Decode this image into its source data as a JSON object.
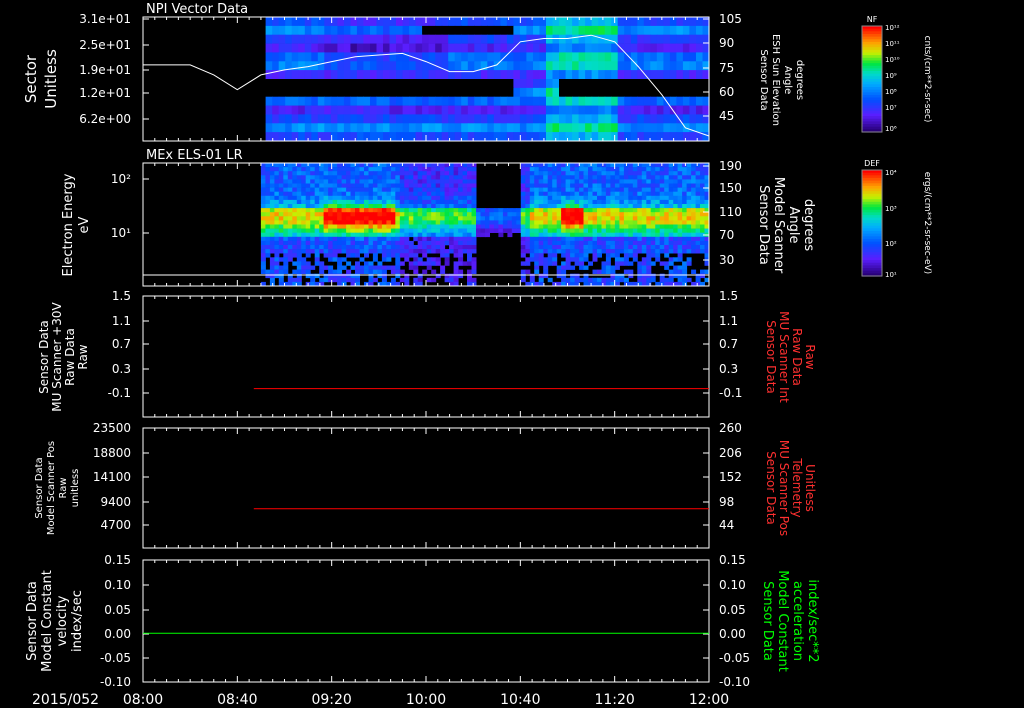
{
  "date_label": "2015/052",
  "time_ticks": [
    "08:00",
    "08:40",
    "09:20",
    "10:00",
    "10:40",
    "11:20",
    "12:00"
  ],
  "colors": {
    "white": "#ffffff",
    "red": "#ff0000",
    "green": "#00ff00",
    "bg": "#000000"
  },
  "chart_data": [
    {
      "type": "heatmap",
      "title": "NPI Vector Data",
      "ylabel": [
        "Sector",
        "Unitless"
      ],
      "yticks": [
        "3.1e+01",
        "2.5e+01",
        "1.9e+01",
        "1.2e+01",
        "6.2e+00"
      ],
      "right_ylabel": [
        "Sensor Data",
        "ESH Sun Elevation",
        "Angle",
        "degrees"
      ],
      "right_yticks": [
        "105",
        "90",
        "75",
        "60",
        "45"
      ],
      "right_ylim": [
        30,
        105
      ],
      "colorbar": {
        "label": "NF",
        "unit": "cnts/(cm**2-sr-sec)",
        "ticks": [
          "10¹²",
          "10¹¹",
          "10¹⁰",
          "10⁹",
          "10⁸",
          "10⁷",
          "10⁶"
        ]
      },
      "data_start": "08:52",
      "series": [
        {
          "x": [
            "08:00",
            "08:20",
            "08:30",
            "08:40",
            "08:50",
            "09:00",
            "09:10",
            "09:20",
            "09:30",
            "09:40",
            "09:50",
            "10:00",
            "10:10",
            "10:20",
            "10:30",
            "10:40",
            "10:50",
            "11:00",
            "11:10",
            "11:20",
            "11:30",
            "11:40",
            "11:50",
            "12:00"
          ],
          "values": [
            76,
            76,
            70,
            61,
            70,
            73,
            75,
            78,
            81,
            82,
            83,
            78,
            72,
            72,
            76,
            90,
            92,
            92,
            94,
            90,
            75,
            58,
            38,
            33
          ]
        }
      ]
    },
    {
      "type": "heatmap",
      "title": "MEx ELS-01 LR",
      "ylabel": [
        "Electron Energy",
        "eV"
      ],
      "yticks": [
        "10²",
        "10¹"
      ],
      "right_ylabel": [
        "Sensor Data",
        "Model Scanner",
        "Angle",
        "degrees"
      ],
      "right_yticks": [
        "190",
        "150",
        "110",
        "70",
        "30"
      ],
      "colorbar": {
        "label": "DEF",
        "unit": "ergs/(cm**2-sr-sec-eV)",
        "ticks": [
          "10⁴",
          "10³",
          "10²",
          "10¹"
        ]
      },
      "data_start": "08:50"
    },
    {
      "type": "line",
      "ylabel": [
        "Sensor Data",
        "MU Scanner +30V",
        "Raw Data",
        "Raw"
      ],
      "yticks": [
        "1.5",
        "1.1",
        "0.7",
        "0.3",
        "-0.1"
      ],
      "ylim": [
        -0.5,
        1.5
      ],
      "right_ylabel": [
        "Sensor Data",
        "MU Scanner Int",
        "Raw Data",
        "Raw"
      ],
      "right_yticks": [
        "1.5",
        "1.1",
        "0.7",
        "0.3",
        "-0.1"
      ],
      "series": [
        {
          "color": "#ff0000",
          "x": [
            "08:47",
            "12:00"
          ],
          "values": [
            -0.03,
            -0.03
          ]
        }
      ]
    },
    {
      "type": "line",
      "ylabel": [
        "Sensor Data",
        "Model Scanner Pos",
        "Raw",
        "unitless"
      ],
      "yticks": [
        "23500",
        "18800",
        "14100",
        "9400",
        "4700"
      ],
      "ylim": [
        0,
        23500
      ],
      "right_ylabel": [
        "Sensor Data",
        "MU Scanner Pos",
        "Telemetry",
        "Unitless"
      ],
      "right_yticks": [
        "260",
        "206",
        "152",
        "98",
        "44"
      ],
      "series": [
        {
          "color": "#ff0000",
          "x": [
            "08:47",
            "12:00"
          ],
          "values": [
            7700,
            7700
          ]
        }
      ]
    },
    {
      "type": "line",
      "ylabel": [
        "Sensor Data",
        "Model Constant",
        "velocity",
        "index/sec"
      ],
      "yticks": [
        "0.15",
        "0.10",
        "0.05",
        "0.00",
        "-0.05",
        "-0.10"
      ],
      "ylim": [
        -0.1,
        0.15
      ],
      "right_ylabel": [
        "Sensor Data",
        "Model Constant",
        "acceleration",
        "index/sec**2"
      ],
      "right_yticks": [
        "0.15",
        "0.10",
        "0.05",
        "0.00",
        "-0.05",
        "-0.10"
      ],
      "series": [
        {
          "color": "#00ff00",
          "x": [
            "08:00",
            "12:00"
          ],
          "values": [
            0.0,
            0.0
          ]
        }
      ]
    }
  ]
}
